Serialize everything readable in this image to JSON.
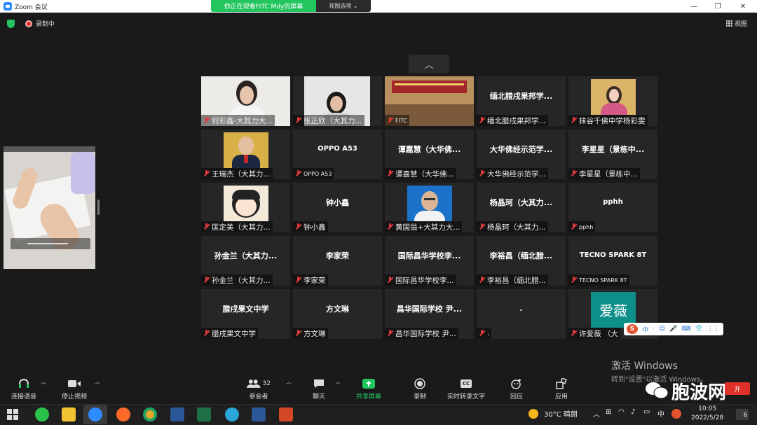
{
  "window": {
    "app_title": "Zoom 会议",
    "min": "—",
    "max": "❐",
    "close": "✕"
  },
  "share_banner": {
    "text": "你正在观看FITC Mdy的屏幕",
    "view_options": "视图选项 ⌄"
  },
  "status": {
    "recording": "录制中",
    "view": "视图"
  },
  "tiles": [
    {
      "name": "何彩鑫-大其力大...",
      "center": "",
      "photo": "girl1"
    },
    {
      "name": "张正欣（大其力...",
      "center": "",
      "photo": "girl2"
    },
    {
      "name": "FITC",
      "center": "",
      "photo": "room",
      "small": true
    },
    {
      "name": "缅北腊戌果邦学...",
      "center": "缅北腊戌果邦学..."
    },
    {
      "name": "抹谷千佛中学杨彩雯",
      "center": "",
      "photo": "woman"
    },
    {
      "name": "王瑞杰（大其力...",
      "center": "",
      "photo": "man"
    },
    {
      "name": "OPPO A53",
      "center": "OPPO A53",
      "small": true
    },
    {
      "name": "谭嘉慧（大华佛...",
      "center": "谭嘉慧（大华佛..."
    },
    {
      "name": "大华佛经示范学...",
      "center": "大华佛经示范学..."
    },
    {
      "name": "李星星（景栋中...",
      "center": "李星星（景栋中..."
    },
    {
      "name": "匡定美（大其力...",
      "center": "",
      "photo": "anime"
    },
    {
      "name": "钟小鑫",
      "center": "钟小鑫"
    },
    {
      "name": "黄国翁+大其力大...",
      "center": "",
      "photo": "oldman"
    },
    {
      "name": "杨晶珂（大其力...",
      "center": "杨晶珂（大其力..."
    },
    {
      "name": "pphh",
      "center": "pphh",
      "small": true
    },
    {
      "name": "孙金兰（大其力...",
      "center": "孙金兰（大其力..."
    },
    {
      "name": "李家荣",
      "center": "李家荣"
    },
    {
      "name": "国际昌华学校李...",
      "center": "国际昌华学校李..."
    },
    {
      "name": "李裕昌（缅北腊...",
      "center": "李裕昌（缅北腊..."
    },
    {
      "name": "TECNO SPARK 8T",
      "center": "TECNO SPARK 8T",
      "small": true
    },
    {
      "name": "腊戌果文中学",
      "center": "腊戌果文中学"
    },
    {
      "name": "方文琳",
      "center": "方文琳"
    },
    {
      "name": "昌华国际学校 尹...",
      "center": "昌华国际学校 尹..."
    },
    {
      "name": ".",
      "center": "."
    },
    {
      "name": "许爱薇 （大",
      "center": "",
      "photo": "aiwei",
      "photo_text": "爱薇"
    }
  ],
  "toolbar": {
    "audio": "连接语音",
    "video": "停止视频",
    "participants": "参会者",
    "participants_count": "32",
    "chat": "聊天",
    "share": "共享屏幕",
    "record": "录制",
    "captions": "实时转录文字",
    "cc": "CC",
    "reactions": "回应",
    "apps": "应用"
  },
  "activate": {
    "line1": "激活 Windows",
    "line2": "转到\"设置\"以激活 Windows。"
  },
  "watermark": "胞波网",
  "red_button": "开",
  "ime": {
    "s": "S",
    "items": [
      "中",
      "·",
      "☺",
      "🎤",
      "⌨",
      "👕",
      "⋮⋮"
    ]
  },
  "taskbar": {
    "weather": "30°C 晴朗",
    "ime": "中",
    "time": "10:05",
    "date": "2022/5/28",
    "notif": "6"
  },
  "colors": {
    "accent": "#2d8cff",
    "green": "#23c55e",
    "red": "#e02b2b"
  }
}
